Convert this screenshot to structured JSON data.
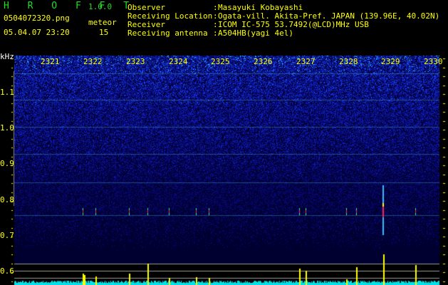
{
  "app": {
    "name": "H R O F F T",
    "version": "1.0.0"
  },
  "file": {
    "name": "0504072320.png",
    "datetime": "05.04.07 23:20"
  },
  "meteor": {
    "label": "meteor",
    "count": "15"
  },
  "info": [
    {
      "label": "Observer",
      "value": "Masayuki Kobayashi"
    },
    {
      "label": "Receiving Location",
      "value": "Ogata-vill. Akita-Pref. JAPAN (139.96E, 40.02N)"
    },
    {
      "label": "Receiver",
      "value": "ICOM IC-575 53.7492(@LCD)MHz USB"
    },
    {
      "label": "Receiving antenna",
      "value": "A504HB(yagi 4el)"
    }
  ],
  "axis": {
    "y_unit": "kHz",
    "y_ticks": [
      "1.1",
      "1.0",
      "0.9",
      "0.8",
      "0.7",
      "0.6"
    ],
    "x_ticks": [
      "2321",
      "2322",
      "2323",
      "2324",
      "2325",
      "2326",
      "2327",
      "2328",
      "2329",
      "2330"
    ]
  },
  "colors": {
    "text": "#ffff00",
    "title": "#22dd22",
    "noise": "#00ffff",
    "background": "#000000"
  }
}
